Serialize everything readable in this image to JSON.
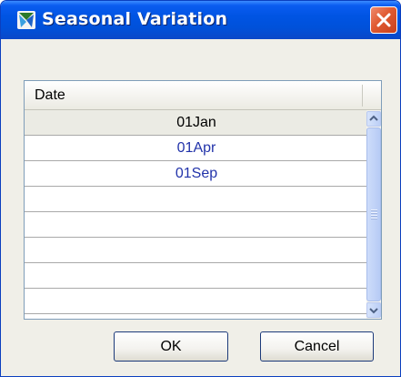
{
  "window": {
    "title": "Seasonal Variation",
    "icon": "app-chart-icon",
    "close_icon": "close-icon"
  },
  "table": {
    "columns": [
      "Date"
    ],
    "rows": [
      {
        "date": "01Jan",
        "selected": true
      },
      {
        "date": "01Apr",
        "selected": false
      },
      {
        "date": "01Sep",
        "selected": false
      },
      {
        "date": "",
        "selected": false
      },
      {
        "date": "",
        "selected": false
      },
      {
        "date": "",
        "selected": false
      },
      {
        "date": "",
        "selected": false
      },
      {
        "date": "",
        "selected": false
      }
    ]
  },
  "buttons": {
    "ok": "OK",
    "cancel": "Cancel"
  },
  "colors": {
    "titlebar": "#0054e3",
    "link_text": "#2233aa",
    "close_button": "#e05a31"
  }
}
